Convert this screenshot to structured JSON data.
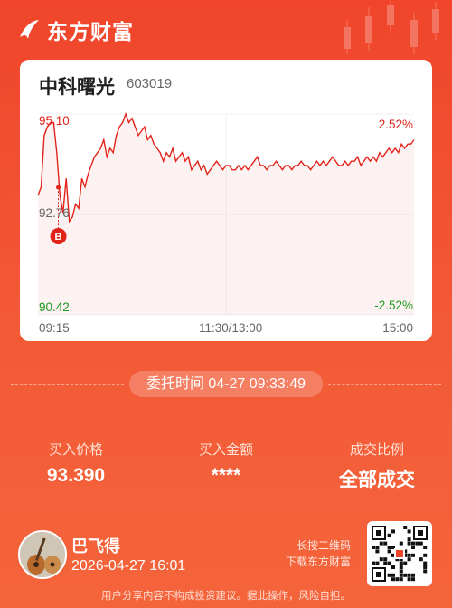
{
  "header": {
    "brand": "东方财富"
  },
  "stock": {
    "name": "中科曙光",
    "code": "603019"
  },
  "chart_data": {
    "type": "line",
    "y_top": "95.10",
    "y_mid": "92.76",
    "y_bottom": "90.42",
    "pct_top": "2.52%",
    "pct_bottom": "-2.52%",
    "x_labels": [
      "09:15",
      "11:30/13:00",
      "15:00"
    ],
    "marker_label": "B",
    "ylim": [
      90.42,
      95.1
    ],
    "x": [
      0,
      2,
      4,
      6,
      8,
      10,
      12,
      14,
      16,
      18,
      20,
      22,
      24,
      26,
      28,
      30,
      32,
      34,
      36,
      38,
      40,
      42,
      44,
      46,
      48,
      50,
      52,
      54,
      56,
      58,
      60,
      62,
      64,
      66,
      68,
      70,
      72,
      74,
      76,
      78,
      80,
      82,
      84,
      86,
      88,
      90,
      92,
      94,
      96,
      98,
      100,
      102,
      104,
      106,
      108,
      110,
      112,
      114,
      116,
      118,
      120,
      122,
      124,
      126,
      128,
      130,
      132,
      134,
      136,
      138,
      140,
      142,
      144,
      146,
      148,
      150,
      152,
      154,
      156,
      158,
      160,
      162,
      164,
      166,
      168,
      170,
      172,
      174,
      176,
      178,
      180,
      182,
      184,
      186,
      188,
      190,
      192,
      194,
      196,
      198,
      200,
      202,
      204,
      206,
      208,
      210,
      212,
      214,
      216,
      218,
      220,
      222,
      224,
      226,
      228,
      230,
      232,
      234,
      236,
      238,
      240
    ],
    "values": [
      93.2,
      93.4,
      94.6,
      94.8,
      94.9,
      94.9,
      94.2,
      93.2,
      92.8,
      93.6,
      92.6,
      92.7,
      93.0,
      92.9,
      93.6,
      93.4,
      93.7,
      93.9,
      94.1,
      94.2,
      94.3,
      94.5,
      94.1,
      94.3,
      94.2,
      94.6,
      94.8,
      94.9,
      95.1,
      94.9,
      95.0,
      94.8,
      94.6,
      94.7,
      94.8,
      94.5,
      94.6,
      94.4,
      94.3,
      94.2,
      94.0,
      94.2,
      94.1,
      94.3,
      94.0,
      94.1,
      94.2,
      94.0,
      94.1,
      93.8,
      93.9,
      94.0,
      93.8,
      93.9,
      93.7,
      93.8,
      93.9,
      94.0,
      93.9,
      93.8,
      93.9,
      93.9,
      93.8,
      93.8,
      93.9,
      93.8,
      93.9,
      93.8,
      93.9,
      94.0,
      94.1,
      93.9,
      93.9,
      93.8,
      93.9,
      93.9,
      94.0,
      93.9,
      93.8,
      93.9,
      93.9,
      93.8,
      93.9,
      93.9,
      94.0,
      93.9,
      93.9,
      93.8,
      93.9,
      94.0,
      93.9,
      94.0,
      93.9,
      94.0,
      94.1,
      94.0,
      93.9,
      93.9,
      94.0,
      93.9,
      94.0,
      94.0,
      94.1,
      93.9,
      94.0,
      94.1,
      94.0,
      94.1,
      94.0,
      94.2,
      94.1,
      94.2,
      94.3,
      94.2,
      94.3,
      94.2,
      94.4,
      94.3,
      94.4,
      94.4,
      94.5
    ],
    "buy_x": 13,
    "buy_price": 93.39
  },
  "order": {
    "time_text": "委托时间 04-27 09:33:49"
  },
  "stats": [
    {
      "label": "买入价格",
      "value": "93.390"
    },
    {
      "label": "买入金额",
      "value": "****"
    },
    {
      "label": "成交比例",
      "value": "全部成交"
    }
  ],
  "user": {
    "name": "巴飞得",
    "datetime": "2026-04-27 16:01"
  },
  "qr": {
    "hint_line1": "长按二维码",
    "hint_line2": "下载东方财富"
  },
  "footer": {
    "disclaimer": "用户分享内容不构成投资建议。据此操作，风险自担。"
  },
  "colors": {
    "up": "#e2231a",
    "down": "#1e9a1e",
    "brand": "#f0452b"
  }
}
